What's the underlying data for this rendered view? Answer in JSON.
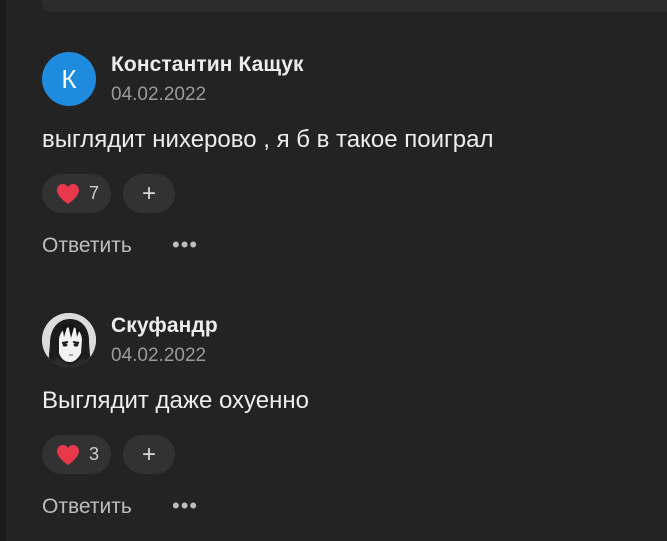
{
  "comments": [
    {
      "author": "Константин Кащук",
      "avatar_letter": "К",
      "date": "04.02.2022",
      "text": "выглядит нихерово , я б в такое поиграл",
      "likes": "7",
      "add_label": "+",
      "reply_label": "Ответить",
      "more_label": "•••"
    },
    {
      "author": "Скуфандр",
      "date": "04.02.2022",
      "text": "Выглядит даже охуенно",
      "likes": "3",
      "add_label": "+",
      "reply_label": "Ответить",
      "more_label": "•••"
    }
  ],
  "colors": {
    "background": "#232323",
    "avatar_blue": "#1f8bdf",
    "heart_red": "#e8394c"
  }
}
